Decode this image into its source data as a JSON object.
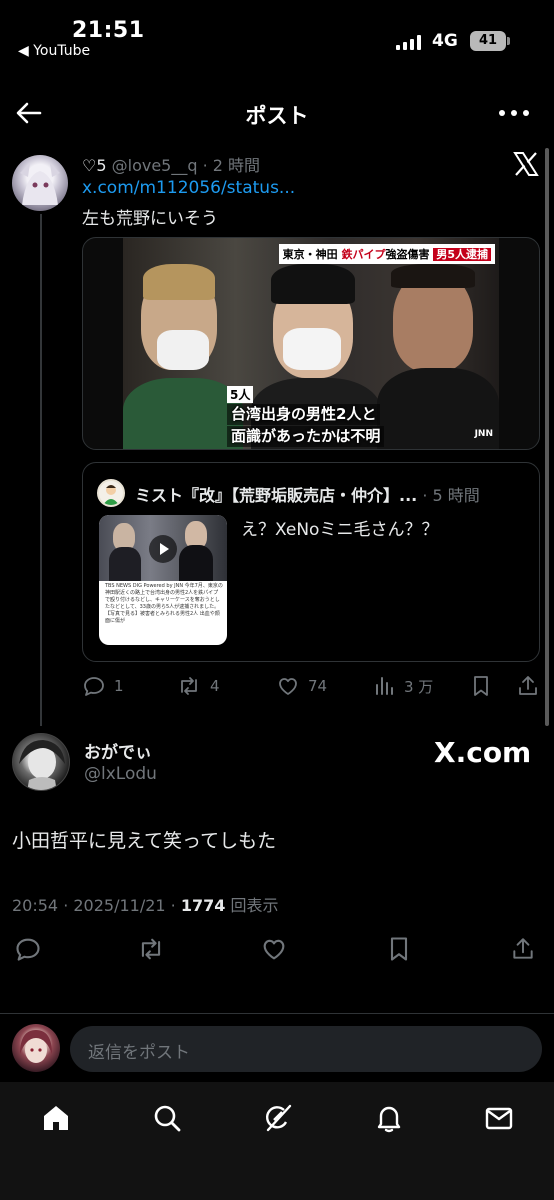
{
  "status_bar": {
    "time": "21:51",
    "back_app": "◀ YouTube",
    "network": "4G",
    "battery": "41"
  },
  "header": {
    "title": "ポスト"
  },
  "parent_post": {
    "likes": "♡5",
    "handle": "@love5__q",
    "time": "· 2 時間",
    "link": "x.com/m112056/status...",
    "text": "左も荒野にいそう",
    "media": {
      "tag_a": "東京・神田",
      "tag_b": "鉄パイプ",
      "tag_c": "強盗傷害",
      "tag_d": "男5人逮捕",
      "count": "5人",
      "caption_1": "台湾出身の男性2人と",
      "caption_2": "面識があったかは不明",
      "logo": "JNN"
    },
    "quote": {
      "author": "ミスト『改』【荒野垢販売店・仲介】...",
      "time": "· 5 時間",
      "text": "え？XeNoミニ毛さん？？",
      "thumb_text": "TBS NEWS DIG Powered by JNN 今年7月、東京の神田駅近くの路上で台湾出身の男性2人を鉄パイプで殴り付けるなどし、キャリーケースを奪おうとしたなどとして、33歳の男ら5人が逮捕されました。 【写真で見る】被害者とみられる男性2人 出血や顔面に傷が"
    },
    "actions": {
      "replies": "1",
      "reposts": "4",
      "likes": "74",
      "views": "3 万"
    }
  },
  "main_post": {
    "author_name": "おがでぃ",
    "handle": "@lxLodu",
    "badge": "X.com",
    "text": "小田哲平に見えて笑ってしもた",
    "time": "20:54 · 2025/11/21 · ",
    "views": "1774",
    "views_label": " 回表示"
  },
  "reply": {
    "placeholder": "返信をポスト"
  },
  "icons": [
    "back-arrow-icon",
    "more-icon",
    "x-logo-icon",
    "reply-icon",
    "repost-icon",
    "like-icon",
    "views-icon",
    "bookmark-icon",
    "share-icon",
    "home-icon",
    "search-icon",
    "grok-icon",
    "notifications-icon",
    "messages-icon"
  ],
  "colors": {
    "link": "#1d9bf0",
    "muted": "#71767b",
    "background": "#000000"
  }
}
